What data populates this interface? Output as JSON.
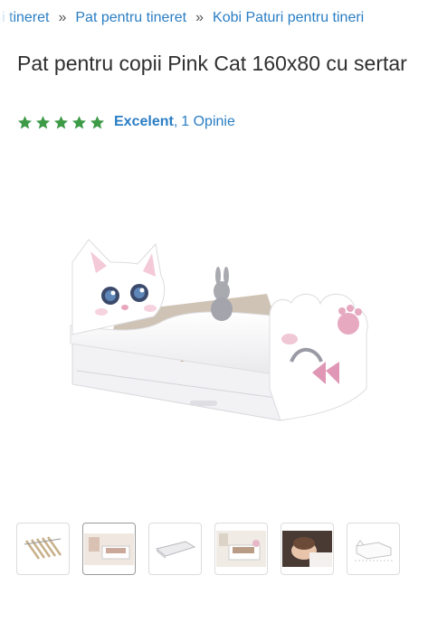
{
  "breadcrumb": {
    "items": [
      "și tineret",
      "Pat pentru tineret",
      "Kobi Paturi pentru tineri"
    ],
    "separator": "»"
  },
  "product": {
    "title": "Pat pentru copii Pink Cat 160x80 cu sertar",
    "rating": {
      "stars": 5,
      "label": "Excelent",
      "separator": ",",
      "reviews_text": "1 Opinie"
    }
  },
  "gallery": {
    "thumbnails": [
      {
        "icon": "slatted-frame-thumbnail"
      },
      {
        "icon": "room-scene-thumbnail"
      },
      {
        "icon": "mattress-thumbnail"
      },
      {
        "icon": "bed-in-room-thumbnail"
      },
      {
        "icon": "child-sleeping-thumbnail"
      },
      {
        "icon": "bed-dimensions-thumbnail"
      }
    ]
  },
  "colors": {
    "link": "#2a7ec4",
    "star": "#3d9a47",
    "text": "#2f2f2f"
  }
}
